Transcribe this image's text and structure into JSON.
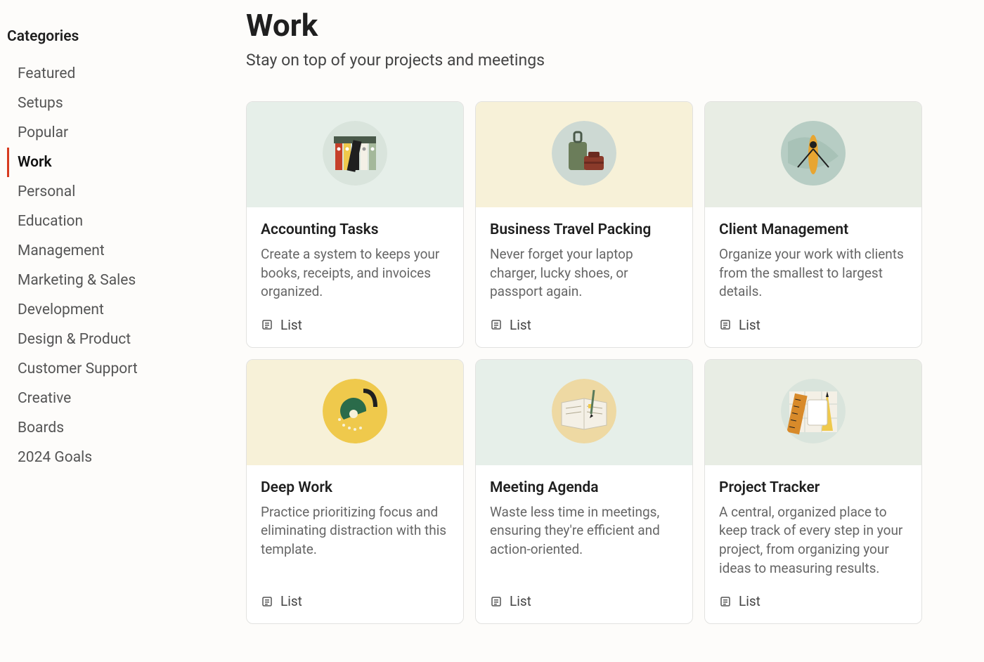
{
  "sidebar": {
    "title": "Categories",
    "items": [
      {
        "label": "Featured",
        "active": false
      },
      {
        "label": "Setups",
        "active": false
      },
      {
        "label": "Popular",
        "active": false
      },
      {
        "label": "Work",
        "active": true
      },
      {
        "label": "Personal",
        "active": false
      },
      {
        "label": "Education",
        "active": false
      },
      {
        "label": "Management",
        "active": false
      },
      {
        "label": "Marketing & Sales",
        "active": false
      },
      {
        "label": "Development",
        "active": false
      },
      {
        "label": "Design & Product",
        "active": false
      },
      {
        "label": "Customer Support",
        "active": false
      },
      {
        "label": "Creative",
        "active": false
      },
      {
        "label": "Boards",
        "active": false
      },
      {
        "label": "2024 Goals",
        "active": false
      }
    ]
  },
  "page": {
    "title": "Work",
    "subtitle": "Stay on top of your projects and meetings"
  },
  "type_label": "List",
  "cards": [
    {
      "title": "Accounting Tasks",
      "desc": "Create a system to keeps your books, receipts, and invoices organized.",
      "hero_bg": "bg-mint",
      "illus": "binders"
    },
    {
      "title": "Business Travel Packing",
      "desc": "Never forget your laptop charger, lucky shoes, or passport again.",
      "hero_bg": "bg-cream",
      "illus": "luggage"
    },
    {
      "title": "Client Management",
      "desc": "Organize your work with clients from the smallest to largest details.",
      "hero_bg": "bg-sage",
      "illus": "rower"
    },
    {
      "title": "Deep Work",
      "desc": "Practice prioritizing focus and eliminating distraction with this template.",
      "hero_bg": "bg-cream",
      "illus": "lamp"
    },
    {
      "title": "Meeting Agenda",
      "desc": "Waste less time in meetings, ensuring they're efficient and action-oriented.",
      "hero_bg": "bg-mint",
      "illus": "notebook"
    },
    {
      "title": "Project Tracker",
      "desc": "A central, organized place to keep track of every step in your project, from organizing your ideas to measuring results.",
      "hero_bg": "bg-sage",
      "illus": "ruler"
    }
  ]
}
